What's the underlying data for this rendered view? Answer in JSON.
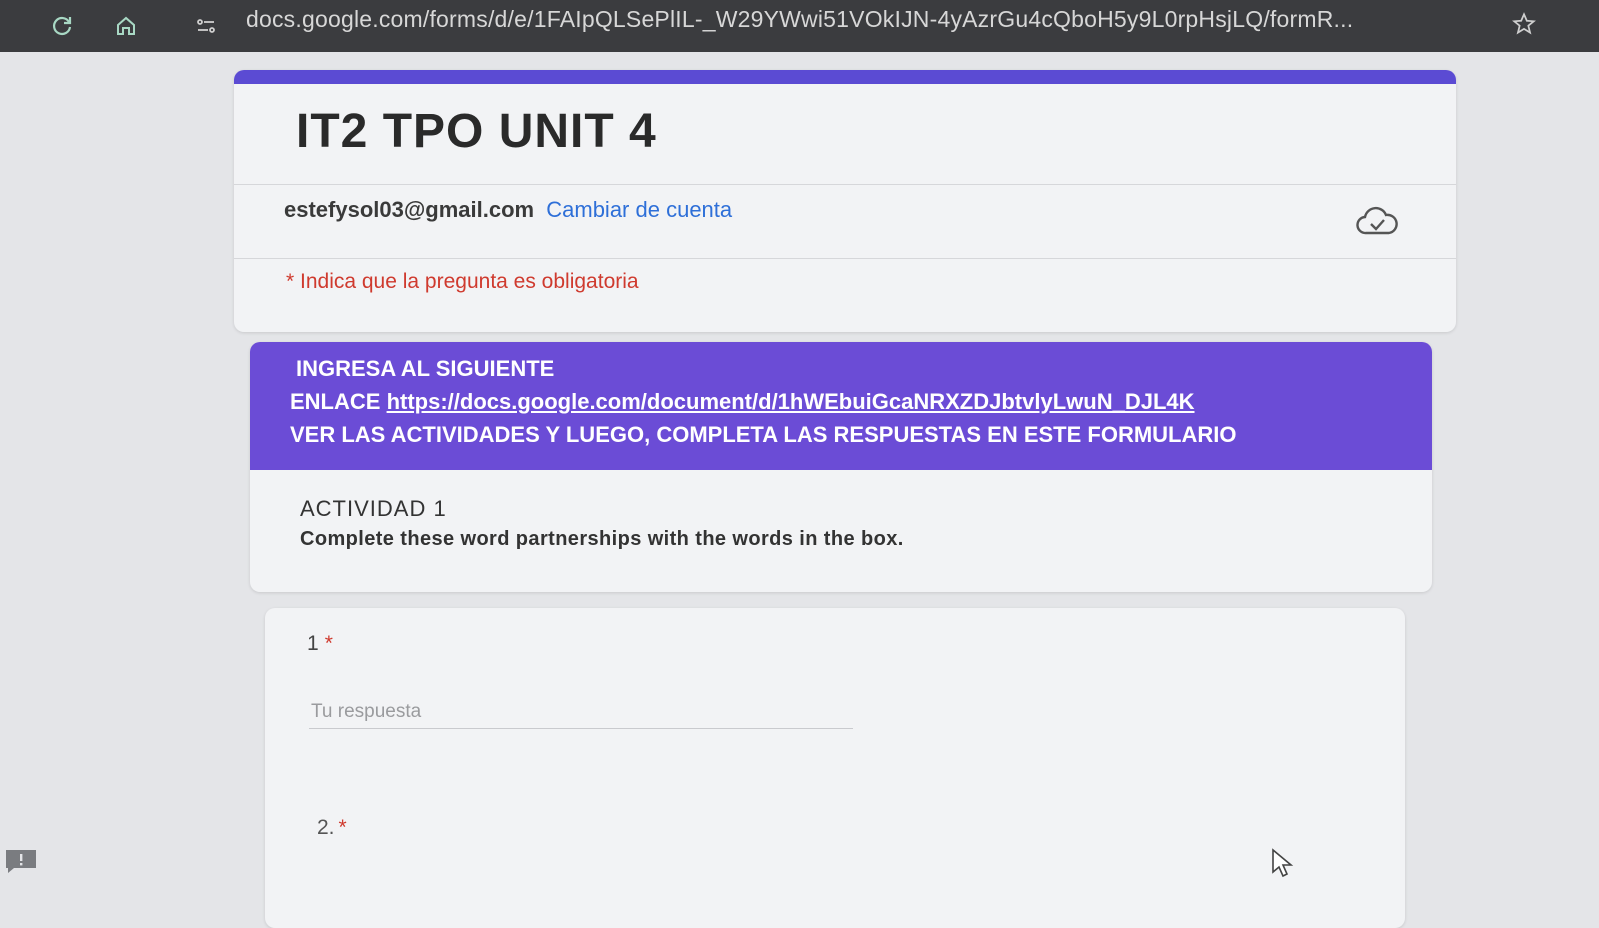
{
  "browser": {
    "url": "docs.google.com/forms/d/e/1FAIpQLSePlIL-_W29YWwi51VOkIJN-4yAzrGu4cQboH5y9L0rpHsjLQ/formR..."
  },
  "form": {
    "title": "IT2 TPO UNIT 4",
    "account_email": "estefysol03@gmail.com",
    "switch_account": "Cambiar de cuenta",
    "required_note": "* Indica que la pregunta es obligatoria"
  },
  "section": {
    "line1": "INGRESA AL  SIGUIENTE",
    "line2_prefix": "ENLACE ",
    "link_text": "https://docs.google.com/document/d/1hWEbuiGcaNRXZDJbtvlyLwuN_DJL4K",
    "line3": "VER LAS ACTIVIDADES Y LUEGO, COMPLETA LAS RESPUESTAS EN ESTE FORMULARIO",
    "activity_title": "ACTIVIDAD 1",
    "activity_desc": "Complete these word partnerships with the words in the box."
  },
  "questions": [
    {
      "number": "1",
      "required_mark": "*",
      "placeholder": "Tu respuesta"
    },
    {
      "number": "2.",
      "required_mark": "*"
    }
  ],
  "colors": {
    "accent": "#5b4bd3",
    "section_header": "#6b4cd6",
    "link": "#2e6fd8",
    "required": "#cf3a2e"
  },
  "icons": [
    "reload-icon",
    "home-icon",
    "site-settings-icon",
    "bookmark-star-icon",
    "cloud-saved-icon",
    "feedback-icon",
    "mouse-cursor"
  ]
}
